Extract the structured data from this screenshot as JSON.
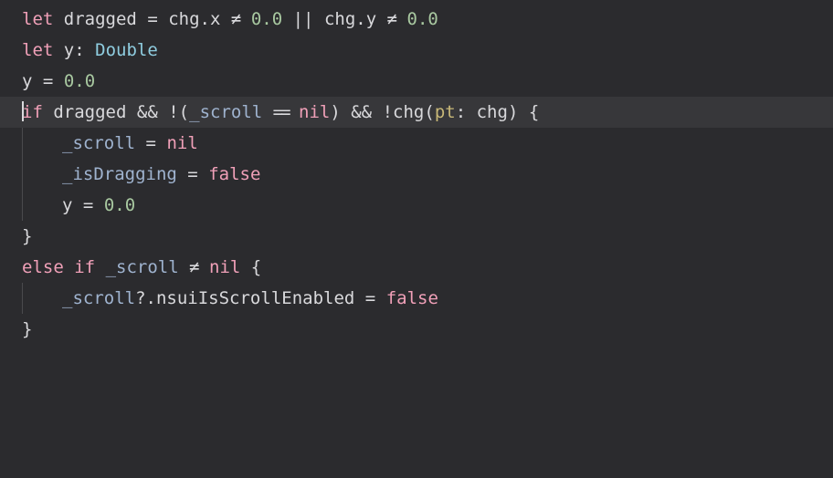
{
  "code": {
    "line1": {
      "let": "let",
      "dragged": "dragged",
      "eq": "=",
      "chg1": "chg",
      "dot1": ".",
      "x": "x",
      "neq1": "≠",
      "zero1": "0.0",
      "or": "||",
      "chg2": "chg",
      "dot2": ".",
      "yf": "y",
      "neq2": "≠",
      "zero2": "0.0"
    },
    "line2": {
      "let": "let",
      "y": "y",
      "colon": ":",
      "type": "Double"
    },
    "line3": {
      "y": "y",
      "eq": "=",
      "zero": "0.0"
    },
    "line4": {
      "if": "if",
      "dragged": "dragged",
      "and1": "&&",
      "bang1": "!",
      "lp": "(",
      "scroll": "_scroll",
      "eqeq": "==",
      "nil": "nil",
      "rp": ")",
      "and2": "&&",
      "bang2": "!",
      "chg": "chg",
      "lp2": "(",
      "pt": "pt",
      "colon": ":",
      "chgArg": "chg",
      "rp2": ")",
      "brace": "{"
    },
    "line5": {
      "scroll": "_scroll",
      "eq": "=",
      "nil": "nil"
    },
    "line6": {
      "isDragging": "_isDragging",
      "eq": "=",
      "false": "false"
    },
    "line7": {
      "y": "y",
      "eq": "=",
      "zero": "0.0"
    },
    "line8": {
      "brace": "}"
    },
    "line9": {
      "else": "else",
      "if": "if",
      "scroll": "_scroll",
      "neq": "≠",
      "nil": "nil",
      "brace": "{"
    },
    "line10": {
      "scroll": "_scroll",
      "q": "?",
      "dot": ".",
      "prop": "nsuiIsScrollEnabled",
      "eq": "=",
      "false": "false"
    },
    "line11": {
      "brace": "}"
    }
  }
}
